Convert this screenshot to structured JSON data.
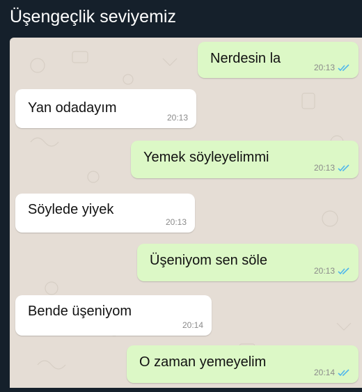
{
  "caption": "Üşengeçlik seviyemiz",
  "colors": {
    "page_background": "#15202b",
    "chat_background": "#e5ddd5",
    "outgoing_bubble": "#dcf8c6",
    "incoming_bubble": "#ffffff",
    "read_ticks": "#4fb6ec"
  },
  "messages": [
    {
      "direction": "outgoing",
      "text": "Nerdesin la",
      "time": "20:13",
      "status_icon": "double-check-icon"
    },
    {
      "direction": "incoming",
      "text": "Yan odadayım",
      "time": "20:13"
    },
    {
      "direction": "outgoing",
      "text": "Yemek söyleyelimmi",
      "time": "20:13",
      "status_icon": "double-check-icon"
    },
    {
      "direction": "incoming",
      "text": "Söylede yiyek",
      "time": "20:13"
    },
    {
      "direction": "outgoing",
      "text": "Üşeniyom sen söle",
      "time": "20:13",
      "status_icon": "double-check-icon"
    },
    {
      "direction": "incoming",
      "text": "Bende üşeniyom",
      "time": "20:14"
    },
    {
      "direction": "outgoing",
      "text": "O zaman yemeyelim",
      "time": "20:14",
      "status_icon": "double-check-icon"
    }
  ]
}
